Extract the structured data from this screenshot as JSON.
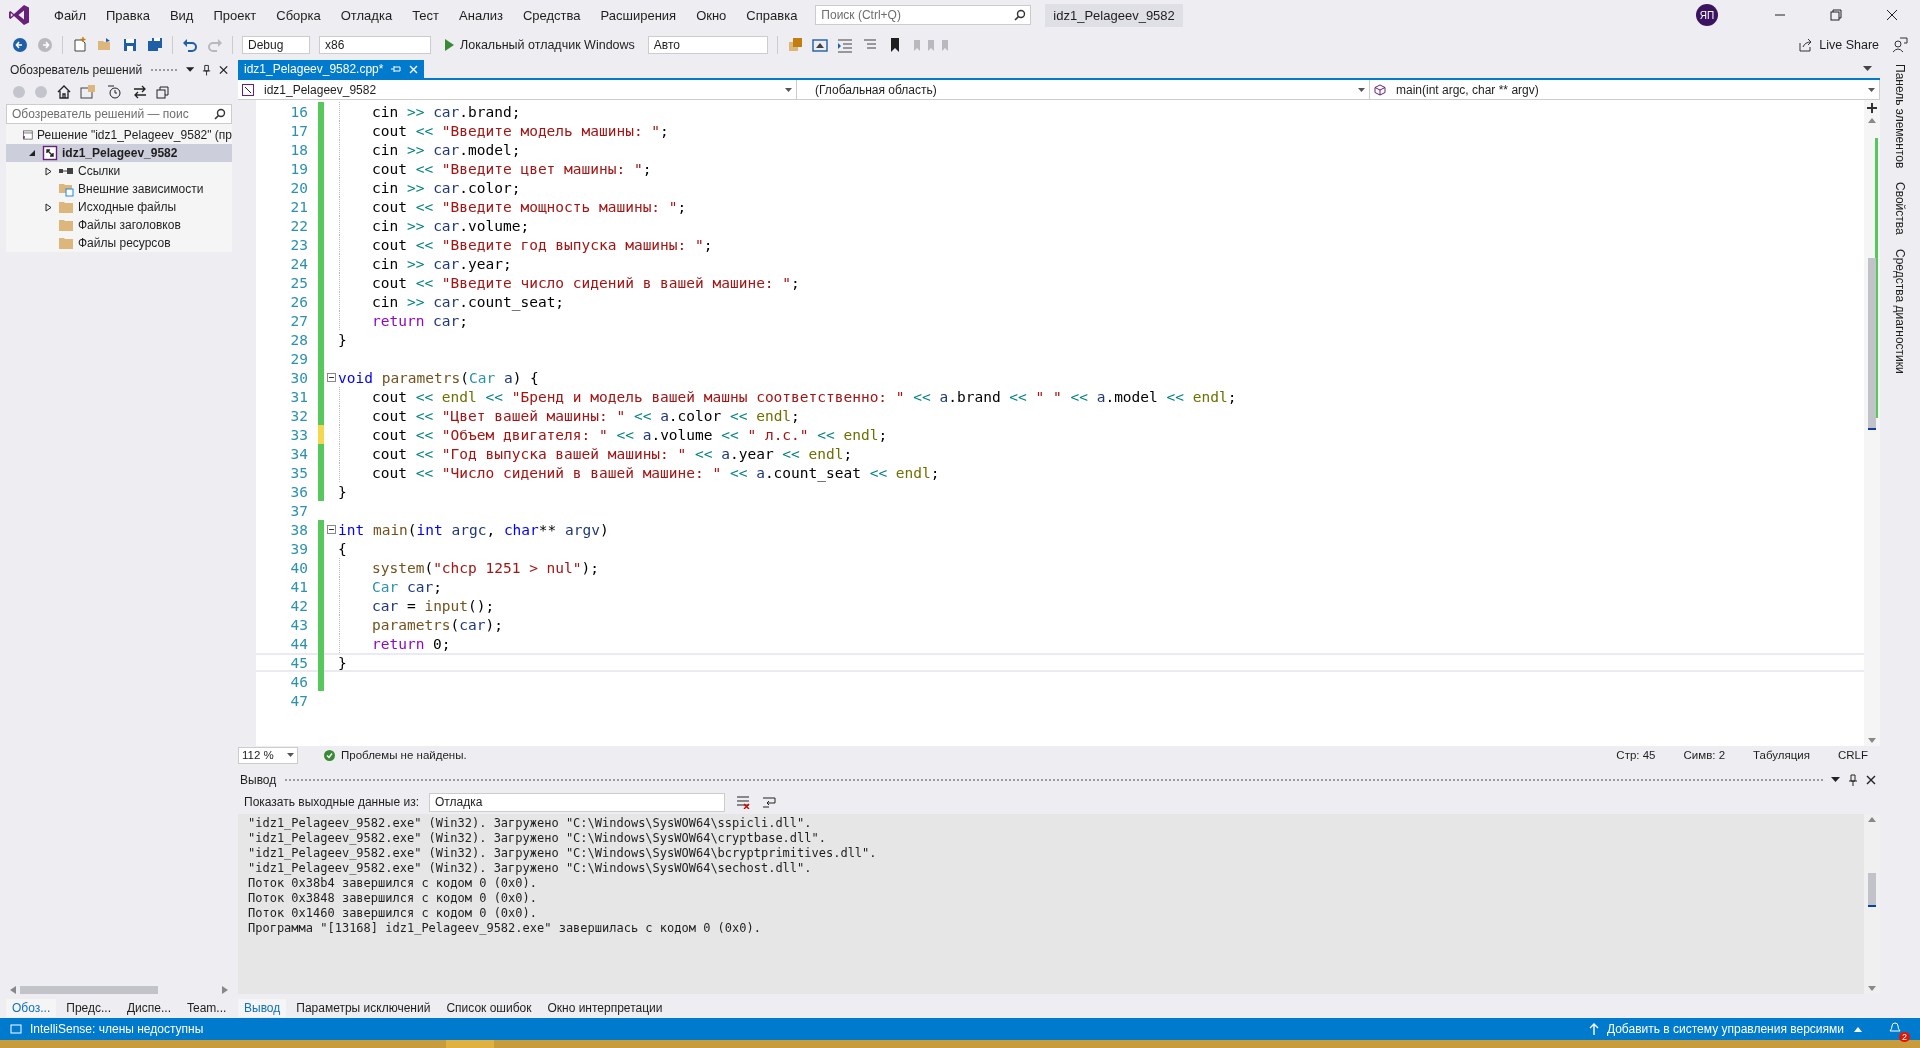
{
  "menu": [
    "Файл",
    "Правка",
    "Вид",
    "Проект",
    "Сборка",
    "Отладка",
    "Тест",
    "Анализ",
    "Средства",
    "Расширения",
    "Окно",
    "Справка"
  ],
  "search": {
    "placeholder": "Поиск (Ctrl+Q)"
  },
  "window": {
    "title": "idz1_Pelageev_9582",
    "avatar": "ЯП"
  },
  "toolbar": {
    "configuration": "Debug",
    "platform": "x86",
    "run_label": "Локальный отладчик Windows",
    "target": "Авто",
    "live_share": "Live Share"
  },
  "solution_explorer": {
    "title": "Обозреватель решений",
    "search_placeholder": "Обозреватель решений — поис",
    "tree": [
      {
        "label": "Решение \"idz1_Pelageev_9582\" (пр",
        "kind": "solution",
        "selected": false,
        "children": [
          {
            "label": "idz1_Pelageev_9582",
            "kind": "project",
            "selected": true,
            "expanded": true,
            "children": [
              {
                "label": "Ссылки",
                "kind": "refs",
                "selected": false,
                "expanded": false
              },
              {
                "label": "Внешние зависимости",
                "kind": "deps",
                "selected": false
              },
              {
                "label": "Исходные файлы",
                "kind": "folder",
                "selected": false,
                "expanded": false
              },
              {
                "label": "Файлы заголовков",
                "kind": "folder",
                "selected": false
              },
              {
                "label": "Файлы ресурсов",
                "kind": "folder",
                "selected": false
              }
            ]
          }
        ]
      }
    ],
    "bottom_tabs": [
      {
        "label": "Обоз...",
        "selected": true
      },
      {
        "label": "Предс...",
        "selected": false
      },
      {
        "label": "Диспе...",
        "selected": false
      },
      {
        "label": "Team...",
        "selected": false
      }
    ]
  },
  "editor": {
    "tab": {
      "label": "idz1_Pelageev_9582.cpp*"
    },
    "nav": {
      "project": "idz1_Pelageev_9582",
      "scope": "(Глобальная область)",
      "member": "main(int argc, char ** argv)"
    },
    "lines": [
      {
        "n": "16",
        "changed": true,
        "saved": true,
        "indented": true,
        "tokens": [
          {
            "text": "cin ",
            "kind": "plain"
          },
          {
            "text": ">> ",
            "kind": "op"
          },
          {
            "text": "car",
            "kind": "var"
          },
          {
            "text": ".brand;",
            "kind": "plain"
          }
        ]
      },
      {
        "n": "17",
        "changed": true,
        "saved": true,
        "indented": true,
        "tokens": [
          {
            "text": "cout ",
            "kind": "plain"
          },
          {
            "text": "<< ",
            "kind": "op"
          },
          {
            "text": "\"Введите модель машины: \"",
            "kind": "str"
          },
          {
            "text": ";",
            "kind": "plain"
          }
        ]
      },
      {
        "n": "18",
        "changed": true,
        "saved": true,
        "indented": true,
        "tokens": [
          {
            "text": "cin ",
            "kind": "plain"
          },
          {
            "text": ">> ",
            "kind": "op"
          },
          {
            "text": "car",
            "kind": "var"
          },
          {
            "text": ".model;",
            "kind": "plain"
          }
        ]
      },
      {
        "n": "19",
        "changed": true,
        "saved": true,
        "indented": true,
        "tokens": [
          {
            "text": "cout ",
            "kind": "plain"
          },
          {
            "text": "<< ",
            "kind": "op"
          },
          {
            "text": "\"Введите цвет машины: \"",
            "kind": "str"
          },
          {
            "text": ";",
            "kind": "plain"
          }
        ]
      },
      {
        "n": "20",
        "changed": true,
        "saved": true,
        "indented": true,
        "tokens": [
          {
            "text": "cin ",
            "kind": "plain"
          },
          {
            "text": ">> ",
            "kind": "op"
          },
          {
            "text": "car",
            "kind": "var"
          },
          {
            "text": ".color;",
            "kind": "plain"
          }
        ]
      },
      {
        "n": "21",
        "changed": true,
        "saved": true,
        "indented": true,
        "tokens": [
          {
            "text": "cout ",
            "kind": "plain"
          },
          {
            "text": "<< ",
            "kind": "op"
          },
          {
            "text": "\"Введите мощность машины: \"",
            "kind": "str"
          },
          {
            "text": ";",
            "kind": "plain"
          }
        ]
      },
      {
        "n": "22",
        "changed": true,
        "saved": true,
        "indented": true,
        "tokens": [
          {
            "text": "cin ",
            "kind": "plain"
          },
          {
            "text": ">> ",
            "kind": "op"
          },
          {
            "text": "car",
            "kind": "var"
          },
          {
            "text": ".volume;",
            "kind": "plain"
          }
        ]
      },
      {
        "n": "23",
        "changed": true,
        "saved": true,
        "indented": true,
        "tokens": [
          {
            "text": "cout ",
            "kind": "plain"
          },
          {
            "text": "<< ",
            "kind": "op"
          },
          {
            "text": "\"Введите год выпуска машины: \"",
            "kind": "str"
          },
          {
            "text": ";",
            "kind": "plain"
          }
        ]
      },
      {
        "n": "24",
        "changed": true,
        "saved": true,
        "indented": true,
        "tokens": [
          {
            "text": "cin ",
            "kind": "plain"
          },
          {
            "text": ">> ",
            "kind": "op"
          },
          {
            "text": "car",
            "kind": "var"
          },
          {
            "text": ".year;",
            "kind": "plain"
          }
        ]
      },
      {
        "n": "25",
        "changed": true,
        "saved": true,
        "indented": true,
        "tokens": [
          {
            "text": "cout ",
            "kind": "plain"
          },
          {
            "text": "<< ",
            "kind": "op"
          },
          {
            "text": "\"Введите число сидений в вашей машине: \"",
            "kind": "str"
          },
          {
            "text": ";",
            "kind": "plain"
          }
        ]
      },
      {
        "n": "26",
        "changed": true,
        "saved": true,
        "indented": true,
        "tokens": [
          {
            "text": "cin ",
            "kind": "plain"
          },
          {
            "text": ">> ",
            "kind": "op"
          },
          {
            "text": "car",
            "kind": "var"
          },
          {
            "text": ".count_seat;",
            "kind": "plain"
          }
        ]
      },
      {
        "n": "27",
        "changed": true,
        "saved": true,
        "indented": true,
        "tokens": [
          {
            "text": "return ",
            "kind": "ctrl"
          },
          {
            "text": "car",
            "kind": "var"
          },
          {
            "text": ";",
            "kind": "plain"
          }
        ]
      },
      {
        "n": "28",
        "changed": true,
        "saved": true,
        "indented": false,
        "tokens": [
          {
            "text": "}",
            "kind": "plain"
          }
        ]
      },
      {
        "n": "29",
        "changed": true,
        "saved": true,
        "indented": false
      },
      {
        "n": "30",
        "changed": true,
        "saved": true,
        "indented": false,
        "fold": true,
        "tokens": [
          {
            "text": "void ",
            "kind": "kw"
          },
          {
            "text": "parametrs",
            "kind": "fn"
          },
          {
            "text": "(",
            "kind": "plain"
          },
          {
            "text": "Car ",
            "kind": "type"
          },
          {
            "text": "a",
            "kind": "var"
          },
          {
            "text": ") {",
            "kind": "plain"
          }
        ]
      },
      {
        "n": "31",
        "changed": true,
        "saved": true,
        "indented": true,
        "tokens": [
          {
            "text": "cout ",
            "kind": "plain"
          },
          {
            "text": "<< ",
            "kind": "op"
          },
          {
            "text": "endl ",
            "kind": "endl"
          },
          {
            "text": "<< ",
            "kind": "op"
          },
          {
            "text": "\"Бренд и модель вашей машны соответственно: \" ",
            "kind": "str"
          },
          {
            "text": "<< ",
            "kind": "op"
          },
          {
            "text": "a",
            "kind": "var"
          },
          {
            "text": ".brand ",
            "kind": "plain"
          },
          {
            "text": "<< ",
            "kind": "op"
          },
          {
            "text": "\" \" ",
            "kind": "str"
          },
          {
            "text": "<< ",
            "kind": "op"
          },
          {
            "text": "a",
            "kind": "var"
          },
          {
            "text": ".model ",
            "kind": "plain"
          },
          {
            "text": "<< ",
            "kind": "op"
          },
          {
            "text": "endl",
            "kind": "endl"
          },
          {
            "text": ";",
            "kind": "plain"
          }
        ]
      },
      {
        "n": "32",
        "changed": true,
        "saved": true,
        "indented": true,
        "tokens": [
          {
            "text": "cout ",
            "kind": "plain"
          },
          {
            "text": "<< ",
            "kind": "op"
          },
          {
            "text": "\"Цвет вашей машины: \" ",
            "kind": "str"
          },
          {
            "text": "<< ",
            "kind": "op"
          },
          {
            "text": "a",
            "kind": "var"
          },
          {
            "text": ".color ",
            "kind": "plain"
          },
          {
            "text": "<< ",
            "kind": "op"
          },
          {
            "text": "endl",
            "kind": "endl"
          },
          {
            "text": ";",
            "kind": "plain"
          }
        ]
      },
      {
        "n": "33",
        "changed": true,
        "saved": false,
        "indented": true,
        "tokens": [
          {
            "text": "cout ",
            "kind": "plain"
          },
          {
            "text": "<< ",
            "kind": "op"
          },
          {
            "text": "\"Объем двигателя: \" ",
            "kind": "str"
          },
          {
            "text": "<< ",
            "kind": "op"
          },
          {
            "text": "a",
            "kind": "var"
          },
          {
            "text": ".volume ",
            "kind": "plain"
          },
          {
            "text": "<< ",
            "kind": "op"
          },
          {
            "text": "\" л.с.\" ",
            "kind": "str"
          },
          {
            "text": "<< ",
            "kind": "op"
          },
          {
            "text": "endl",
            "kind": "endl"
          },
          {
            "text": ";",
            "kind": "plain"
          }
        ]
      },
      {
        "n": "34",
        "changed": true,
        "saved": true,
        "indented": true,
        "tokens": [
          {
            "text": "cout ",
            "kind": "plain"
          },
          {
            "text": "<< ",
            "kind": "op"
          },
          {
            "text": "\"Год выпуска вашей машины: \" ",
            "kind": "str"
          },
          {
            "text": "<< ",
            "kind": "op"
          },
          {
            "text": "a",
            "kind": "var"
          },
          {
            "text": ".year ",
            "kind": "plain"
          },
          {
            "text": "<< ",
            "kind": "op"
          },
          {
            "text": "endl",
            "kind": "endl"
          },
          {
            "text": ";",
            "kind": "plain"
          }
        ]
      },
      {
        "n": "35",
        "changed": true,
        "saved": true,
        "indented": true,
        "tokens": [
          {
            "text": "cout ",
            "kind": "plain"
          },
          {
            "text": "<< ",
            "kind": "op"
          },
          {
            "text": "\"Число сидений в вашей машине: \" ",
            "kind": "str"
          },
          {
            "text": "<< ",
            "kind": "op"
          },
          {
            "text": "a",
            "kind": "var"
          },
          {
            "text": ".count_seat ",
            "kind": "plain"
          },
          {
            "text": "<< ",
            "kind": "op"
          },
          {
            "text": "endl",
            "kind": "endl"
          },
          {
            "text": ";",
            "kind": "plain"
          }
        ]
      },
      {
        "n": "36",
        "changed": true,
        "saved": true,
        "indented": false,
        "tokens": [
          {
            "text": "}",
            "kind": "plain"
          }
        ]
      },
      {
        "n": "37",
        "changed": false,
        "indented": false
      },
      {
        "n": "38",
        "changed": true,
        "saved": true,
        "indented": false,
        "fold": true,
        "tokens": [
          {
            "text": "int ",
            "kind": "kw"
          },
          {
            "text": "main",
            "kind": "fn"
          },
          {
            "text": "(",
            "kind": "plain"
          },
          {
            "text": "int ",
            "kind": "kw"
          },
          {
            "text": "argc",
            "kind": "var"
          },
          {
            "text": ", ",
            "kind": "plain"
          },
          {
            "text": "char",
            "kind": "kw"
          },
          {
            "text": "** ",
            "kind": "plain"
          },
          {
            "text": "argv",
            "kind": "var"
          },
          {
            "text": ")",
            "kind": "plain"
          }
        ]
      },
      {
        "n": "39",
        "changed": true,
        "saved": true,
        "indented": false,
        "tokens": [
          {
            "text": "{",
            "kind": "plain"
          }
        ]
      },
      {
        "n": "40",
        "changed": true,
        "saved": true,
        "indented": true,
        "tokens": [
          {
            "text": "system",
            "kind": "fn"
          },
          {
            "text": "(",
            "kind": "plain"
          },
          {
            "text": "\"chcp 1251 > nul\"",
            "kind": "str"
          },
          {
            "text": ");",
            "kind": "plain"
          }
        ]
      },
      {
        "n": "41",
        "changed": true,
        "saved": true,
        "indented": true,
        "tokens": [
          {
            "text": "Car ",
            "kind": "type"
          },
          {
            "text": "car",
            "kind": "var"
          },
          {
            "text": ";",
            "kind": "plain"
          }
        ]
      },
      {
        "n": "42",
        "changed": true,
        "saved": true,
        "indented": true,
        "tokens": [
          {
            "text": "car",
            "kind": "var"
          },
          {
            "text": " = ",
            "kind": "plain"
          },
          {
            "text": "input",
            "kind": "fn"
          },
          {
            "text": "();",
            "kind": "plain"
          }
        ]
      },
      {
        "n": "43",
        "changed": true,
        "saved": true,
        "indented": true,
        "tokens": [
          {
            "text": "parametrs",
            "kind": "fn"
          },
          {
            "text": "(",
            "kind": "plain"
          },
          {
            "text": "car",
            "kind": "var"
          },
          {
            "text": ");",
            "kind": "plain"
          }
        ]
      },
      {
        "n": "44",
        "changed": true,
        "saved": true,
        "indented": true,
        "tokens": [
          {
            "text": "return ",
            "kind": "ctrl"
          },
          {
            "text": "0;",
            "kind": "plain"
          }
        ]
      },
      {
        "n": "45",
        "changed": true,
        "saved": true,
        "indented": false,
        "current": true,
        "tokens": [
          {
            "text": "}",
            "kind": "plain"
          }
        ]
      },
      {
        "n": "46",
        "changed": true,
        "saved": true,
        "indented": false
      },
      {
        "n": "47",
        "changed": false,
        "indented": false
      }
    ],
    "status": {
      "zoom": "112 %",
      "problems": "Проблемы не найдены.",
      "line": "Стр: 45",
      "col": "Симв: 2",
      "indent": "Табуляция",
      "eol": "CRLF"
    }
  },
  "output": {
    "title": "Вывод",
    "source_label": "Показать выходные данные из:",
    "source": "Отладка",
    "lines": [
      "\"idz1_Pelageev_9582.exe\" (Win32). Загружено \"C:\\Windows\\SysWOW64\\sspicli.dll\".",
      "\"idz1_Pelageev_9582.exe\" (Win32). Загружено \"C:\\Windows\\SysWOW64\\cryptbase.dll\".",
      "\"idz1_Pelageev_9582.exe\" (Win32). Загружено \"C:\\Windows\\SysWOW64\\bcryptprimitives.dll\".",
      "\"idz1_Pelageev_9582.exe\" (Win32). Загружено \"C:\\Windows\\SysWOW64\\sechost.dll\".",
      "Поток 0x38b4 завершился с кодом 0 (0x0).",
      "Поток 0x3848 завершился с кодом 0 (0x0).",
      "Поток 0x1460 завершился с кодом 0 (0x0).",
      "Программа \"[13168] idz1_Pelageev_9582.exe\" завершилась с кодом 0 (0x0)."
    ],
    "tabs": [
      {
        "label": "Вывод",
        "selected": true
      },
      {
        "label": "Параметры исключений",
        "selected": false
      },
      {
        "label": "Список ошибок",
        "selected": false
      },
      {
        "label": "Окно интерпретации",
        "selected": false
      }
    ]
  },
  "side_tabs": [
    "Панель элементов",
    "Свойства",
    "Средства диагностики"
  ],
  "status_bar": {
    "left": "IntelliSense: члены недоступны",
    "source_control": "Добавить в систему управления версиями",
    "notifications": "2"
  }
}
